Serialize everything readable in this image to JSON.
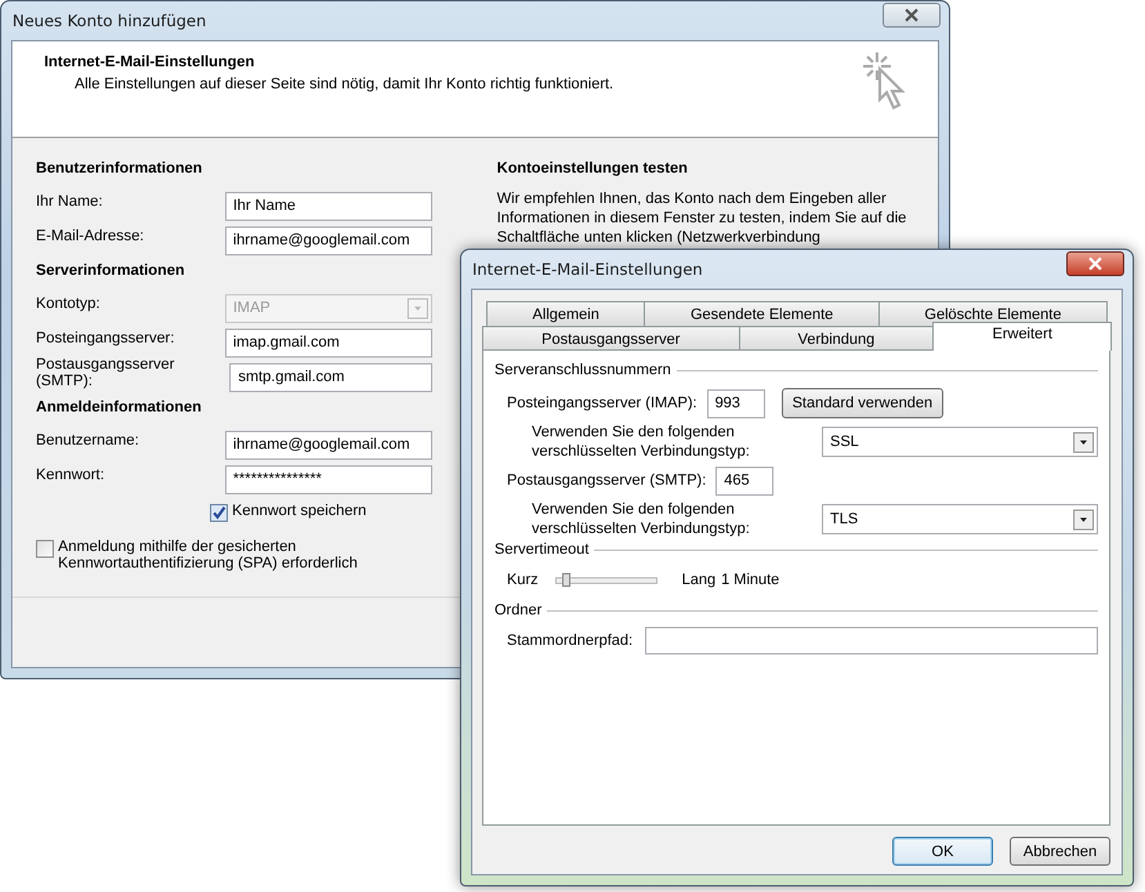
{
  "main_window": {
    "title": "Neues Konto hinzufügen",
    "header": {
      "title": "Internet-E-Mail-Einstellungen",
      "subtitle": "Alle Einstellungen auf dieser Seite sind nötig, damit Ihr Konto richtig funktioniert."
    },
    "sections": [
      {
        "heading": "Benutzerinformationen",
        "fields": [
          {
            "kind": "text",
            "label": "Ihr Name:",
            "value": "Ihr Name"
          },
          {
            "kind": "text",
            "label": "E-Mail-Adresse:",
            "value": "ihrname@googlemail.com"
          }
        ]
      },
      {
        "heading": "Serverinformationen",
        "fields": [
          {
            "kind": "select",
            "label": "Kontotyp:",
            "value": "IMAP",
            "disabled": true
          },
          {
            "kind": "text",
            "label": "Posteingangsserver:",
            "value": "imap.gmail.com"
          },
          {
            "kind": "text",
            "label": "Postausgangsserver (SMTP):",
            "value": "smtp.gmail.com"
          }
        ]
      },
      {
        "heading": "Anmeldeinformationen",
        "fields": [
          {
            "kind": "text",
            "label": "Benutzername:",
            "value": "ihrname@googlemail.com"
          },
          {
            "kind": "password",
            "label": "Kennwort:",
            "value": "***************"
          }
        ]
      }
    ],
    "remember_password": {
      "label": "Kennwort speichern",
      "checked": true
    },
    "spa": {
      "label": "Anmeldung mithilfe der gesicherten Kennwortauthentifizierung (SPA) erforderlich",
      "checked": false
    },
    "test": {
      "heading": "Kontoeinstellungen testen",
      "text": "Wir empfehlen Ihnen, das Konto nach dem Eingeben aller Informationen in diesem Fenster zu testen, indem Sie auf die Schaltfläche unten klicken (Netzwerkverbindung"
    }
  },
  "dialog": {
    "title": "Internet-E-Mail-Einstellungen",
    "tab_rows": [
      [
        {
          "label": "Allgemein",
          "selected": false
        },
        {
          "label": "Gesendete Elemente",
          "selected": false
        },
        {
          "label": "Gelöschte Elemente",
          "selected": false
        }
      ],
      [
        {
          "label": "Postausgangsserver",
          "selected": false
        },
        {
          "label": "Verbindung",
          "selected": false
        },
        {
          "label": "Erweitert",
          "selected": true
        }
      ]
    ],
    "ports": {
      "heading": "Serveranschlussnummern",
      "servers": [
        {
          "label": "Posteingangsserver (IMAP):",
          "port": "993",
          "button": "Standard verwenden",
          "encryption_label": "Verwenden Sie den folgenden verschlüsselten Verbindungstyp:",
          "encryption": "SSL"
        },
        {
          "label": "Postausgangsserver (SMTP):",
          "port": "465",
          "encryption_label": "Verwenden Sie den folgenden verschlüsselten Verbindungstyp:",
          "encryption": "TLS"
        }
      ]
    },
    "timeout": {
      "heading": "Servertimeout",
      "min_label": "Kurz",
      "max_label": "Lang",
      "level": 0.1,
      "reading": "1 Minute"
    },
    "folders": {
      "heading": "Ordner",
      "label": "Stammordnerpfad:"
    },
    "buttons": [
      {
        "label": "OK",
        "default": true
      },
      {
        "label": "Abbrechen",
        "default": false
      }
    ]
  }
}
